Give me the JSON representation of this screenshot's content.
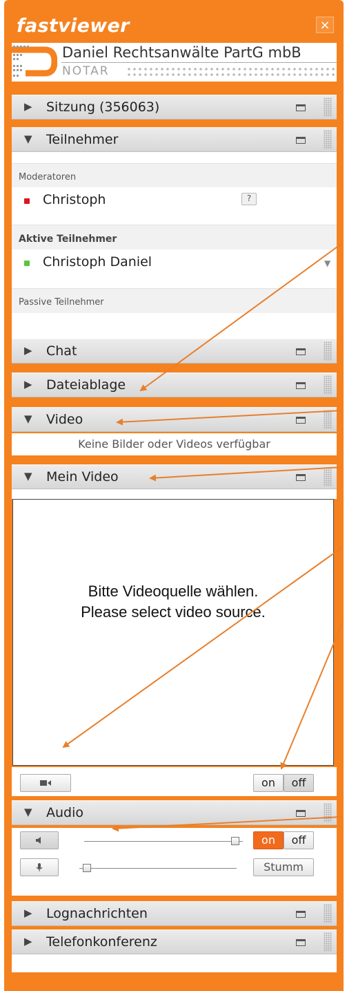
{
  "app": {
    "logo": "fastviewer",
    "close_icon": "×"
  },
  "brand": {
    "name": "Daniel Rechtsanwälte PartG mbB",
    "sub": "NOTAR"
  },
  "sections": {
    "sitzung": {
      "label": "Sitzung (356063)",
      "arrow": "▶"
    },
    "teilnehmer": {
      "label": "Teilnehmer",
      "arrow": "▼"
    },
    "chat": {
      "label": "Chat",
      "arrow": "▶"
    },
    "dateiablage": {
      "label": "Dateiablage",
      "arrow": "▶"
    },
    "video": {
      "label": "Video",
      "arrow": "▼"
    },
    "mein_video": {
      "label": "Mein Video",
      "arrow": "▼"
    },
    "audio": {
      "label": "Audio",
      "arrow": "▼"
    },
    "lognachrichten": {
      "label": "Lognachrichten",
      "arrow": "▶"
    },
    "telefonkonferenz": {
      "label": "Telefonkonferenz",
      "arrow": "▶"
    }
  },
  "participants": {
    "moderators_label": "Moderatoren",
    "moderators": [
      {
        "name": "Christoph",
        "status_color": "#e0141e",
        "badge": "?"
      }
    ],
    "active_label": "Aktive Teilnehmer",
    "active": [
      {
        "name": "Christoph Daniel",
        "status_color": "#5cc43a"
      }
    ],
    "passive_label": "Passive Teilnehmer"
  },
  "video": {
    "empty_text": "Keine Bilder oder Videos verfügbar"
  },
  "my_video": {
    "message_de": "Bitte Videoquelle wählen.",
    "message_en": "Please select video source.",
    "on_label": "on",
    "off_label": "off",
    "state": "off"
  },
  "audio": {
    "speaker_on_label": "on",
    "speaker_off_label": "off",
    "speaker_state": "on",
    "mute_label": "Stumm",
    "speaker_volume": 0.95,
    "mic_volume": 0.02
  },
  "colors": {
    "frame": "#f5821f",
    "accent_button": "#f26b1d",
    "annotation_arrow": "#e87f2c"
  }
}
